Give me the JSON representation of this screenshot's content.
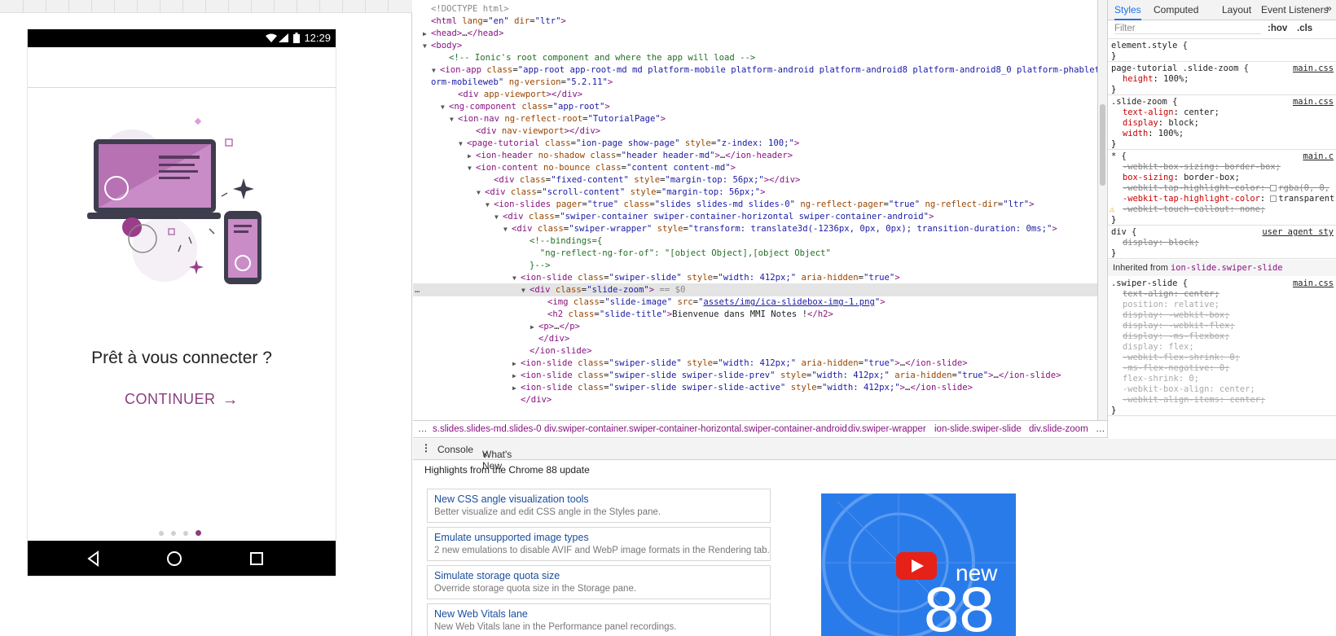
{
  "phone": {
    "status_time": "12:29",
    "slide_title": "Prêt à vous connecter ?",
    "continue_label": "CONTINUER",
    "dots_count": 4,
    "active_dot": 4
  },
  "elements_panel": {
    "lines": [
      {
        "indent": 0,
        "html": "<span class='gr'>&lt;!DOCTYPE html&gt;</span>"
      },
      {
        "indent": 0,
        "html": "<span class='tg'>&lt;html</span> <span class='at'>lang</span>=<span class='av'>\"en\"</span> <span class='at'>dir</span>=<span class='av'>\"ltr\"</span><span class='tg'>&gt;</span>"
      },
      {
        "indent": 0,
        "tri": "▶",
        "html": "<span class='tg'>&lt;head&gt;</span>…<span class='tg'>&lt;/head&gt;</span>"
      },
      {
        "indent": 0,
        "tri": "▼",
        "html": "<span class='tg'>&lt;body&gt;</span>"
      },
      {
        "indent": 2,
        "html": "<span class='cm'>&lt;!-- Ionic's root component and where the app will load --&gt;</span>"
      },
      {
        "indent": 1,
        "tri": "▼",
        "html": "<span class='tg'>&lt;ion-app</span> <span class='at'>class</span>=<span class='av'>\"app-root app-root-md md platform-mobile platform-android platform-android8 platform-android8_0 platform-phablet platf</span>"
      },
      {
        "indent": 0,
        "html": "<span class='av'>orm-mobileweb\"</span> <span class='at'>ng-version</span>=<span class='av'>\"5.2.11\"</span><span class='tg'>&gt;</span>"
      },
      {
        "indent": 3,
        "html": "<span class='tg'>&lt;div</span> <span class='at'>app-viewport</span><span class='tg'>&gt;&lt;/div&gt;</span>"
      },
      {
        "indent": 2,
        "tri": "▼",
        "html": "<span class='tg'>&lt;ng-component</span> <span class='at'>class</span>=<span class='av'>\"app-root\"</span><span class='tg'>&gt;</span>"
      },
      {
        "indent": 3,
        "tri": "▼",
        "html": "<span class='tg'>&lt;ion-nav</span> <span class='at'>ng-reflect-root</span>=<span class='av'>\"TutorialPage\"</span><span class='tg'>&gt;</span>"
      },
      {
        "indent": 5,
        "html": "<span class='tg'>&lt;div</span> <span class='at'>nav-viewport</span><span class='tg'>&gt;&lt;/div&gt;</span>"
      },
      {
        "indent": 4,
        "tri": "▼",
        "html": "<span class='tg'>&lt;page-tutorial</span> <span class='at'>class</span>=<span class='av'>\"ion-page show-page\"</span> <span class='at'>style</span>=<span class='av'>\"z-index: 100;\"</span><span class='tg'>&gt;</span>"
      },
      {
        "indent": 5,
        "tri": "▶",
        "html": "<span class='tg'>&lt;ion-header</span> <span class='at'>no-shadow</span> <span class='at'>class</span>=<span class='av'>\"header header-md\"</span><span class='tg'>&gt;</span>…<span class='tg'>&lt;/ion-header&gt;</span>"
      },
      {
        "indent": 5,
        "tri": "▼",
        "html": "<span class='tg'>&lt;ion-content</span> <span class='at'>no-bounce</span> <span class='at'>class</span>=<span class='av'>\"content content-md\"</span><span class='tg'>&gt;</span>"
      },
      {
        "indent": 7,
        "html": "<span class='tg'>&lt;div</span> <span class='at'>class</span>=<span class='av'>\"fixed-content\"</span> <span class='at'>style</span>=<span class='av'>\"margin-top: 56px;\"</span><span class='tg'>&gt;&lt;/div&gt;</span>"
      },
      {
        "indent": 6,
        "tri": "▼",
        "html": "<span class='tg'>&lt;div</span> <span class='at'>class</span>=<span class='av'>\"scroll-content\"</span> <span class='at'>style</span>=<span class='av'>\"margin-top: 56px;\"</span><span class='tg'>&gt;</span>"
      },
      {
        "indent": 7,
        "tri": "▼",
        "html": "<span class='tg'>&lt;ion-slides</span> <span class='at'>pager</span>=<span class='av'>\"true\"</span> <span class='at'>class</span>=<span class='av'>\"slides slides-md slides-0\"</span> <span class='at'>ng-reflect-pager</span>=<span class='av'>\"true\"</span> <span class='at'>ng-reflect-dir</span>=<span class='av'>\"ltr\"</span><span class='tg'>&gt;</span>"
      },
      {
        "indent": 8,
        "tri": "▼",
        "html": "<span class='tg'>&lt;div</span> <span class='at'>class</span>=<span class='av'>\"swiper-container swiper-container-horizontal swiper-container-android\"</span><span class='tg'>&gt;</span>"
      },
      {
        "indent": 9,
        "tri": "▼",
        "html": "<span class='tg'>&lt;div</span> <span class='at'>class</span>=<span class='av'>\"swiper-wrapper\"</span> <span class='at'>style</span>=<span class='av'>\"transform: translate3d(-1236px, 0px, 0px); transition-duration: 0ms;\"</span><span class='tg'>&gt;</span>"
      },
      {
        "indent": 11,
        "html": "<span class='cm'>&lt;!--bindings={</span>"
      },
      {
        "indent": 11,
        "html": "<span class='cm'>&nbsp;&nbsp;\"ng-reflect-ng-for-of\": \"[object Object],[object Object\"</span>"
      },
      {
        "indent": 11,
        "html": "<span class='cm'>}--&gt;</span>"
      },
      {
        "indent": 10,
        "tri": "▼",
        "html": "<span class='tg'>&lt;ion-slide</span> <span class='at'>class</span>=<span class='av'>\"swiper-slide\"</span> <span class='at'>style</span>=<span class='av'>\"width: 412px;\"</span> <span class='at'>aria-hidden</span>=<span class='av'>\"true\"</span><span class='tg'>&gt;</span>"
      },
      {
        "indent": 11,
        "tri": "▼",
        "sel": true,
        "html": "<span class='tg'>&lt;div</span> <span class='at'>class</span>=<span class='av'>\"slide-zoom\"</span><span class='tg'>&gt;</span> <span class='gr'>== $0</span>"
      },
      {
        "indent": 13,
        "html": "<span class='tg'>&lt;img</span> <span class='at'>class</span>=<span class='av'>\"slide-image\"</span> <span class='at'>src</span>=<span class='av'>\"<span class='lnk'>assets/img/ica-slidebox-img-1.png</span>\"</span><span class='tg'>&gt;</span>"
      },
      {
        "indent": 13,
        "html": "<span class='tg'>&lt;h2</span> <span class='at'>class</span>=<span class='av'>\"slide-title\"</span><span class='tg'>&gt;</span>Bienvenue dans MMI Notes !<span class='tg'>&lt;/h2&gt;</span>"
      },
      {
        "indent": 12,
        "tri": "▶",
        "html": "<span class='tg'>&lt;p&gt;</span>…<span class='tg'>&lt;/p&gt;</span>"
      },
      {
        "indent": 12,
        "html": "<span class='tg'>&lt;/div&gt;</span>"
      },
      {
        "indent": 11,
        "html": "<span class='tg'>&lt;/ion-slide&gt;</span>"
      },
      {
        "indent": 10,
        "tri": "▶",
        "html": "<span class='tg'>&lt;ion-slide</span> <span class='at'>class</span>=<span class='av'>\"swiper-slide\"</span> <span class='at'>style</span>=<span class='av'>\"width: 412px;\"</span> <span class='at'>aria-hidden</span>=<span class='av'>\"true\"</span><span class='tg'>&gt;</span>…<span class='tg'>&lt;/ion-slide&gt;</span>"
      },
      {
        "indent": 10,
        "tri": "▶",
        "html": "<span class='tg'>&lt;ion-slide</span> <span class='at'>class</span>=<span class='av'>\"swiper-slide swiper-slide-prev\"</span> <span class='at'>style</span>=<span class='av'>\"width: 412px;\"</span> <span class='at'>aria-hidden</span>=<span class='av'>\"true\"</span><span class='tg'>&gt;</span>…<span class='tg'>&lt;/ion-slide&gt;</span>"
      },
      {
        "indent": 10,
        "tri": "▶",
        "html": "<span class='tg'>&lt;ion-slide</span> <span class='at'>class</span>=<span class='av'>\"swiper-slide swiper-slide-active\"</span> <span class='at'>style</span>=<span class='av'>\"width: 412px;\"</span><span class='tg'>&gt;</span>…<span class='tg'>&lt;/ion-slide&gt;</span>"
      },
      {
        "indent": 10,
        "html": "<span class='tg'>&lt;/div&gt;</span>"
      }
    ]
  },
  "breadcrumbs": [
    "s.slides.slides-md.slides-0",
    "div.swiper-container.swiper-container-horizontal.swiper-container-android",
    "div.swiper-wrapper",
    "ion-slide.swiper-slide",
    "div.slide-zoom"
  ],
  "styles_panel": {
    "tabs": [
      "Styles",
      "Computed",
      "Layout",
      "Event Listeners"
    ],
    "more": "»",
    "filter_placeholder": "Filter",
    "hov": ":hov",
    "cls": ".cls",
    "rules": [
      {
        "selector": "element.style {",
        "props": []
      },
      {
        "selector": "page-tutorial .slide-zoom {",
        "source": "main.css",
        "props": [
          {
            "p": "height",
            "v": "100%;"
          }
        ]
      },
      {
        "selector": ".slide-zoom {",
        "source": "main.css",
        "props": [
          {
            "p": "text-align",
            "v": "center;"
          },
          {
            "p": "display",
            "v": "block;"
          },
          {
            "p": "width",
            "v": "100%;"
          }
        ]
      },
      {
        "selector": "* {",
        "source": "main.c",
        "props": [
          {
            "p": "-webkit-box-sizing",
            "v": "border-box;",
            "strike": true
          },
          {
            "p": "box-sizing",
            "v": "border-box;"
          },
          {
            "p": "-webkit-tap-highlight-color",
            "v": "rgba(0, 0,",
            "strike": true,
            "swatch": true
          },
          {
            "p": "-webkit-tap-highlight-color",
            "v": "transparent",
            "swatch": true
          },
          {
            "p": "-webkit-touch-callout",
            "v": "none;",
            "strike": true,
            "warn": true
          }
        ]
      },
      {
        "selector": "div {",
        "source": "user agent sty",
        "props": [
          {
            "p": "display",
            "v": "block;",
            "strike": true
          }
        ]
      }
    ],
    "inherited_label": "Inherited from",
    "inherited_from": "ion-slide.swiper-slide",
    "inherited_rule": {
      "selector": ".swiper-slide {",
      "source": "main.css",
      "props": [
        {
          "p": "text-align",
          "v": "center;",
          "strike": true
        },
        {
          "p": "position",
          "v": "relative;",
          "dim": true
        },
        {
          "p": "display",
          "v": "-webkit-box;",
          "strike": true,
          "dim": true
        },
        {
          "p": "display",
          "v": "-webkit-flex;",
          "strike": true,
          "dim": true
        },
        {
          "p": "display",
          "v": "-ms-flexbox;",
          "strike": true,
          "dim": true
        },
        {
          "p": "display",
          "v": "flex;",
          "dim": true
        },
        {
          "p": "-webkit-flex-shrink",
          "v": "0;",
          "strike": true,
          "dim": true
        },
        {
          "p": "-ms-flex-negative",
          "v": "0;",
          "strike": true,
          "dim": true
        },
        {
          "p": "flex-shrink",
          "v": "0;",
          "dim": true
        },
        {
          "p": "-webkit-box-align",
          "v": "center;",
          "dim": true
        },
        {
          "p": "-webkit-align-items",
          "v": "center;",
          "strike": true,
          "dim": true
        }
      ]
    }
  },
  "drawer": {
    "tabs": [
      "Console",
      "What's New"
    ],
    "close": "×",
    "highlights_title": "Highlights from the Chrome 88 update",
    "cards": [
      {
        "title": "New CSS angle visualization tools",
        "desc": "Better visualize and edit CSS angle in the Styles pane."
      },
      {
        "title": "Emulate unsupported image types",
        "desc": "2 new emulations to disable AVIF and WebP image formats in the Rendering tab."
      },
      {
        "title": "Simulate storage quota size",
        "desc": "Override storage quota size in the Storage pane."
      },
      {
        "title": "New Web Vitals lane",
        "desc": "New Web Vitals lane in the Performance panel recordings."
      }
    ],
    "video": {
      "new_label": "new",
      "version": "88"
    }
  },
  "colors": {
    "brand": "#8b3e7d",
    "devtools_accent": "#1a73e8",
    "video_bg": "#2a7bea",
    "youtube_red": "#e62117"
  }
}
